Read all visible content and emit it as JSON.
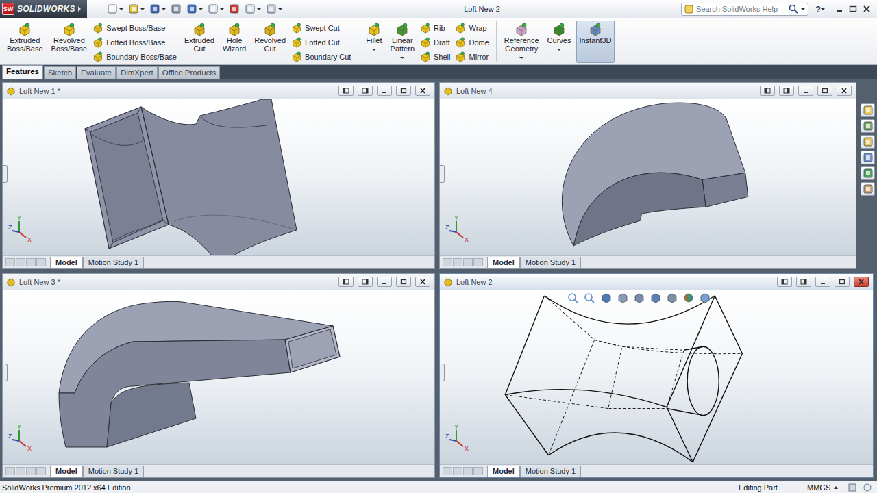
{
  "app": {
    "logo_mark": "SW",
    "logo_text": "SOLIDWORKS"
  },
  "window": {
    "title": "Loft New 2"
  },
  "search": {
    "placeholder": "Search SolidWorks Help"
  },
  "help": "?",
  "ribbon": [
    {
      "kind": "large",
      "lines": [
        "Extruded",
        "Boss/Base"
      ],
      "dropdown": false,
      "selected": false
    },
    {
      "kind": "large",
      "lines": [
        "Revolved",
        "Boss/Base"
      ],
      "dropdown": false,
      "selected": false
    },
    {
      "kind": "stack",
      "items": [
        "Swept Boss/Base",
        "Lofted Boss/Base",
        "Boundary Boss/Base"
      ]
    },
    {
      "kind": "large",
      "lines": [
        "Extruded",
        "Cut"
      ],
      "dropdown": false,
      "selected": false
    },
    {
      "kind": "large",
      "lines": [
        "Hole",
        "Wizard"
      ],
      "dropdown": false,
      "selected": false
    },
    {
      "kind": "large",
      "lines": [
        "Revolved",
        "Cut"
      ],
      "dropdown": false,
      "selected": false
    },
    {
      "kind": "stack",
      "items": [
        "Swept Cut",
        "Lofted Cut",
        "Boundary Cut"
      ]
    },
    {
      "kind": "separator"
    },
    {
      "kind": "large",
      "lines": [
        "Fillet"
      ],
      "dropdown": true,
      "selected": false
    },
    {
      "kind": "large",
      "lines": [
        "Linear",
        "Pattern"
      ],
      "dropdown": true,
      "selected": false
    },
    {
      "kind": "stack",
      "items": [
        "Rib",
        "Draft",
        "Shell"
      ]
    },
    {
      "kind": "stack",
      "items": [
        "Wrap",
        "Dome",
        "Mirror"
      ]
    },
    {
      "kind": "separator"
    },
    {
      "kind": "large",
      "lines": [
        "Reference",
        "Geometry"
      ],
      "dropdown": true,
      "selected": false
    },
    {
      "kind": "large",
      "lines": [
        "Curves"
      ],
      "dropdown": true,
      "selected": false
    },
    {
      "kind": "large",
      "lines": [
        "Instant3D"
      ],
      "dropdown": false,
      "selected": true
    }
  ],
  "tabs": [
    {
      "label": "Features",
      "selected": true
    },
    {
      "label": "Sketch",
      "selected": false
    },
    {
      "label": "Evaluate",
      "selected": false
    },
    {
      "label": "DimXpert",
      "selected": false
    },
    {
      "label": "Office Products",
      "selected": false
    }
  ],
  "documents": [
    {
      "title": "Loft New 1 *",
      "active": false,
      "model": "flared-shell",
      "tabs": [
        {
          "label": "Model",
          "selected": true
        },
        {
          "label": "Motion Study 1",
          "selected": false
        }
      ]
    },
    {
      "title": "Loft New 4",
      "active": false,
      "model": "curved-sweep",
      "tabs": [
        {
          "label": "Model",
          "selected": true
        },
        {
          "label": "Motion Study 1",
          "selected": false
        }
      ]
    },
    {
      "title": "Loft New 3 *",
      "active": false,
      "model": "elbow-duct",
      "tabs": [
        {
          "label": "Model",
          "selected": true
        },
        {
          "label": "Motion Study 1",
          "selected": false
        }
      ]
    },
    {
      "title": "Loft New 2",
      "active": true,
      "model": "wireframe-loft",
      "tabs": [
        {
          "label": "Model",
          "selected": true
        },
        {
          "label": "Motion Study 1",
          "selected": false
        }
      ]
    }
  ],
  "triad": {
    "x": "X",
    "y": "Y",
    "z": "Z"
  },
  "status_bar": {
    "edition": "SolidWorks Premium 2012 x64 Edition",
    "mode": "Editing Part",
    "units": "MMGS"
  }
}
